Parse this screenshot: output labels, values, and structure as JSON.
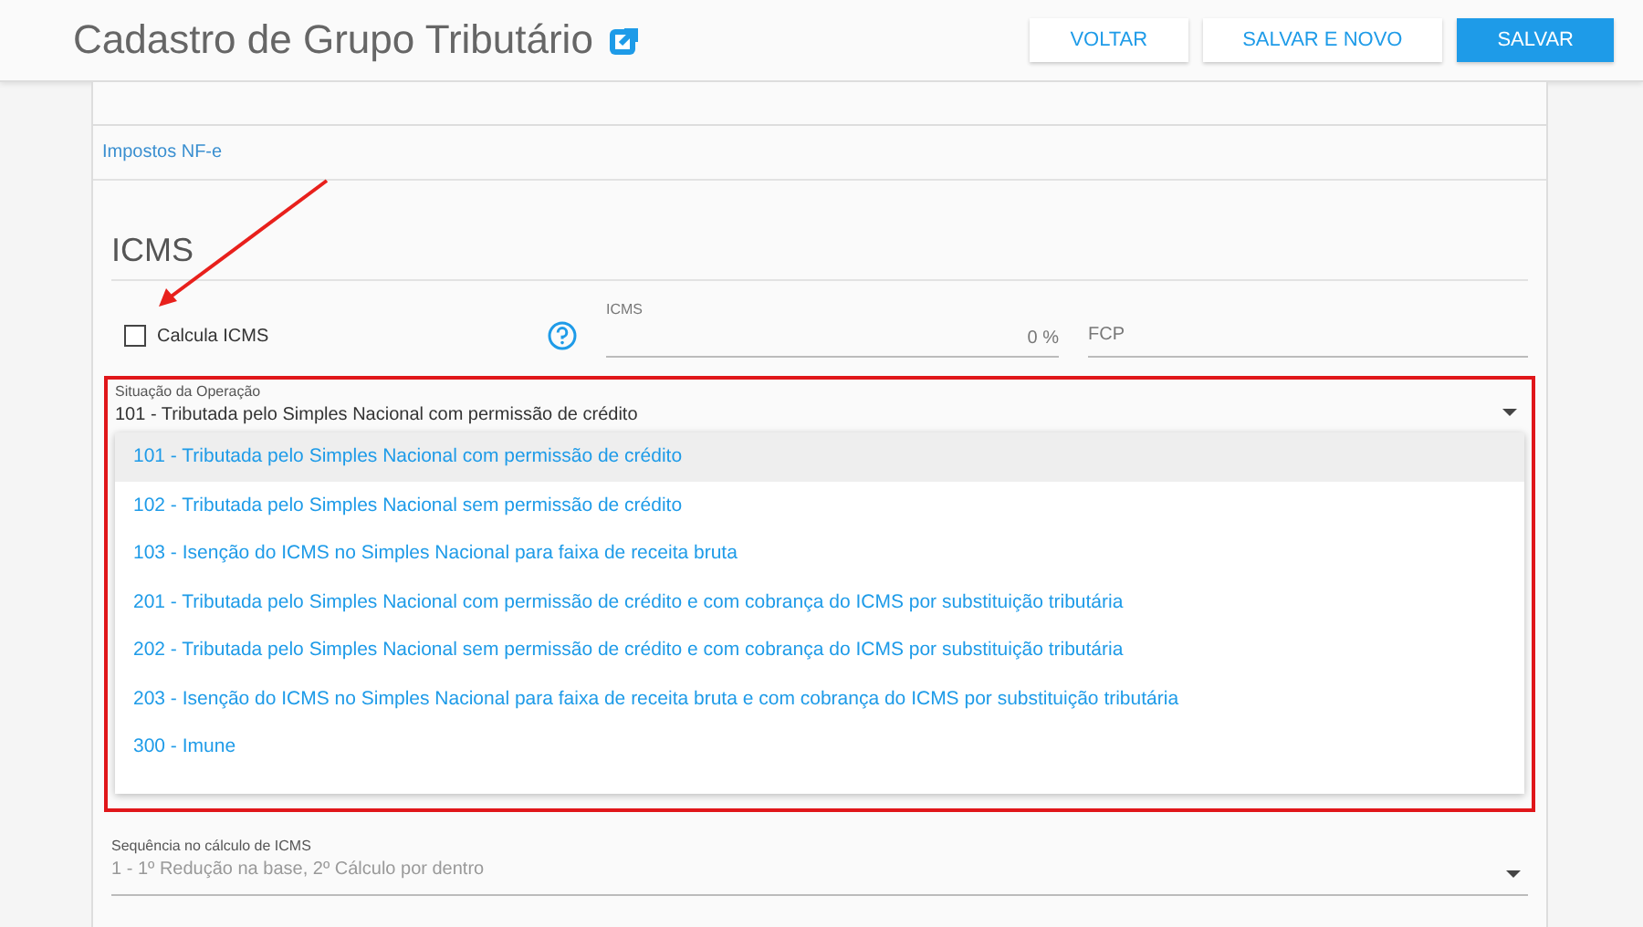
{
  "header": {
    "title": "Cadastro de Grupo Tributário",
    "buttons": [
      {
        "label": "VOLTAR",
        "kind": "secondary"
      },
      {
        "label": "SALVAR E NOVO",
        "kind": "secondary"
      },
      {
        "label": "SALVAR",
        "kind": "primary"
      }
    ]
  },
  "panel": {
    "tab": "Impostos NF-e",
    "section_title": "ICMS",
    "calcula_icms": {
      "label": "Calcula ICMS",
      "checked": false
    },
    "icms_field": {
      "label": "ICMS",
      "placeholder": "0",
      "suffix": "%"
    },
    "fcp_field": {
      "placeholder": "FCP"
    },
    "situacao": {
      "label": "Situação da Operação",
      "value": "101 - Tributada pelo Simples Nacional com permissão de crédito",
      "options": [
        {
          "label": "101 - Tributada pelo Simples Nacional com permissão de crédito",
          "selected": true
        },
        {
          "label": "102 - Tributada pelo Simples Nacional sem permissão de crédito",
          "selected": false
        },
        {
          "label": "103 - Isenção do ICMS no Simples Nacional para faixa de receita bruta",
          "selected": false
        },
        {
          "label": "201 - Tributada pelo Simples Nacional com permissão de crédito e com cobrança do ICMS por substituição tributária",
          "selected": false
        },
        {
          "label": "202 - Tributada pelo Simples Nacional sem permissão de crédito e com cobrança do ICMS por substituição tributária",
          "selected": false
        },
        {
          "label": "203 - Isenção do ICMS no Simples Nacional para faixa de receita bruta e com cobrança do ICMS por substituição tributária",
          "selected": false
        },
        {
          "label": "300 - Imune",
          "selected": false
        }
      ]
    },
    "sequencia": {
      "label": "Sequência no cálculo de ICMS",
      "placeholder": "1 - 1º Redução na base, 2º Cálculo por dentro"
    }
  }
}
